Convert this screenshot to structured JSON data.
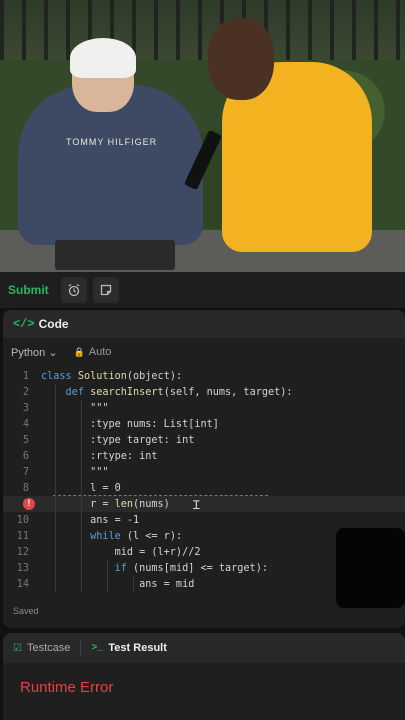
{
  "photo": {
    "shirt_text": "TOMMY HILFIGER"
  },
  "toolbar": {
    "submit_label": "Submit",
    "timer_icon": "alarm-icon",
    "note_icon": "notes-icon"
  },
  "code_panel": {
    "icon": "</>",
    "title": "Code",
    "language": "Python",
    "language_chevron": "⌄",
    "mode": "Auto",
    "status": "Saved",
    "lines": [
      {
        "n": "1",
        "text": "class Solution(object):"
      },
      {
        "n": "2",
        "text": "    def searchInsert(self, nums, target):"
      },
      {
        "n": "3",
        "text": "        \"\"\""
      },
      {
        "n": "4",
        "text": "        :type nums: List[int]"
      },
      {
        "n": "5",
        "text": "        :type target: int"
      },
      {
        "n": "6",
        "text": "        :rtype: int"
      },
      {
        "n": "7",
        "text": "        \"\"\""
      },
      {
        "n": "8",
        "text": "        l = 0"
      },
      {
        "n": "9",
        "text": "        r = len(nums)"
      },
      {
        "n": "10",
        "text": "        ans = -1"
      },
      {
        "n": "11",
        "text": "        while (l <= r):"
      },
      {
        "n": "12",
        "text": "            mid = (l+r)//2"
      },
      {
        "n": "13",
        "text": "            if (nums[mid] <= target):"
      },
      {
        "n": "14",
        "text": "                ans = mid"
      }
    ],
    "breakpoint_line": "9"
  },
  "test_panel": {
    "tab_testcase": "Testcase",
    "tab_result": "Test Result",
    "result": "Runtime Error"
  },
  "colors": {
    "accent_green": "#2db55d",
    "error_red": "#e5413d",
    "keyword_blue": "#5b9dd9"
  }
}
